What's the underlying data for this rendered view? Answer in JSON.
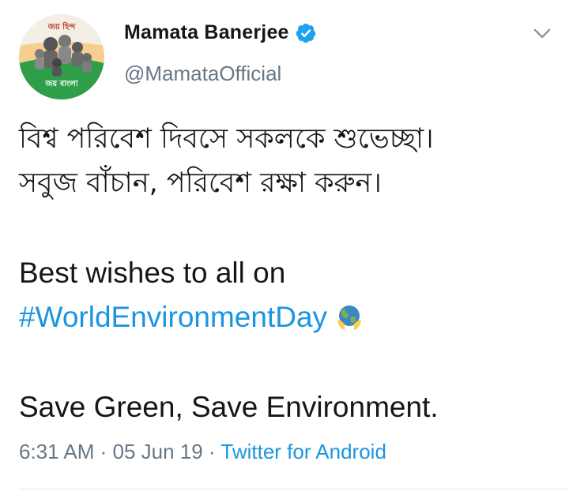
{
  "user": {
    "display_name": "Mamata Banerjee",
    "handle": "@MamataOfficial",
    "verified": true,
    "avatar_text_top": "জয় হিন্দ",
    "avatar_text_bottom": "জয় বাংলা"
  },
  "tweet": {
    "bengali_line1": "বিশ্ব পরিবেশ দিবসে সকলকে শুভেচ্ছা।",
    "bengali_line2": "সবুজ বাঁচান, পরিবেশ রক্ষা করুন।",
    "english_line1": "Best wishes to all on",
    "hashtag": "#WorldEnvironmentDay",
    "english_line3": "Save Green, Save Environment."
  },
  "meta": {
    "time": "6:31 AM",
    "separator": " · ",
    "date": "05 Jun 19",
    "separator2": " · ",
    "source": "Twitter for Android"
  },
  "icons": {
    "verified": "verified-badge-icon",
    "menu": "chevron-down-icon",
    "emoji": "earth-globe-icon"
  },
  "colors": {
    "link": "#1b95e0",
    "secondary_text": "#657786",
    "verified": "#1da1f2"
  }
}
